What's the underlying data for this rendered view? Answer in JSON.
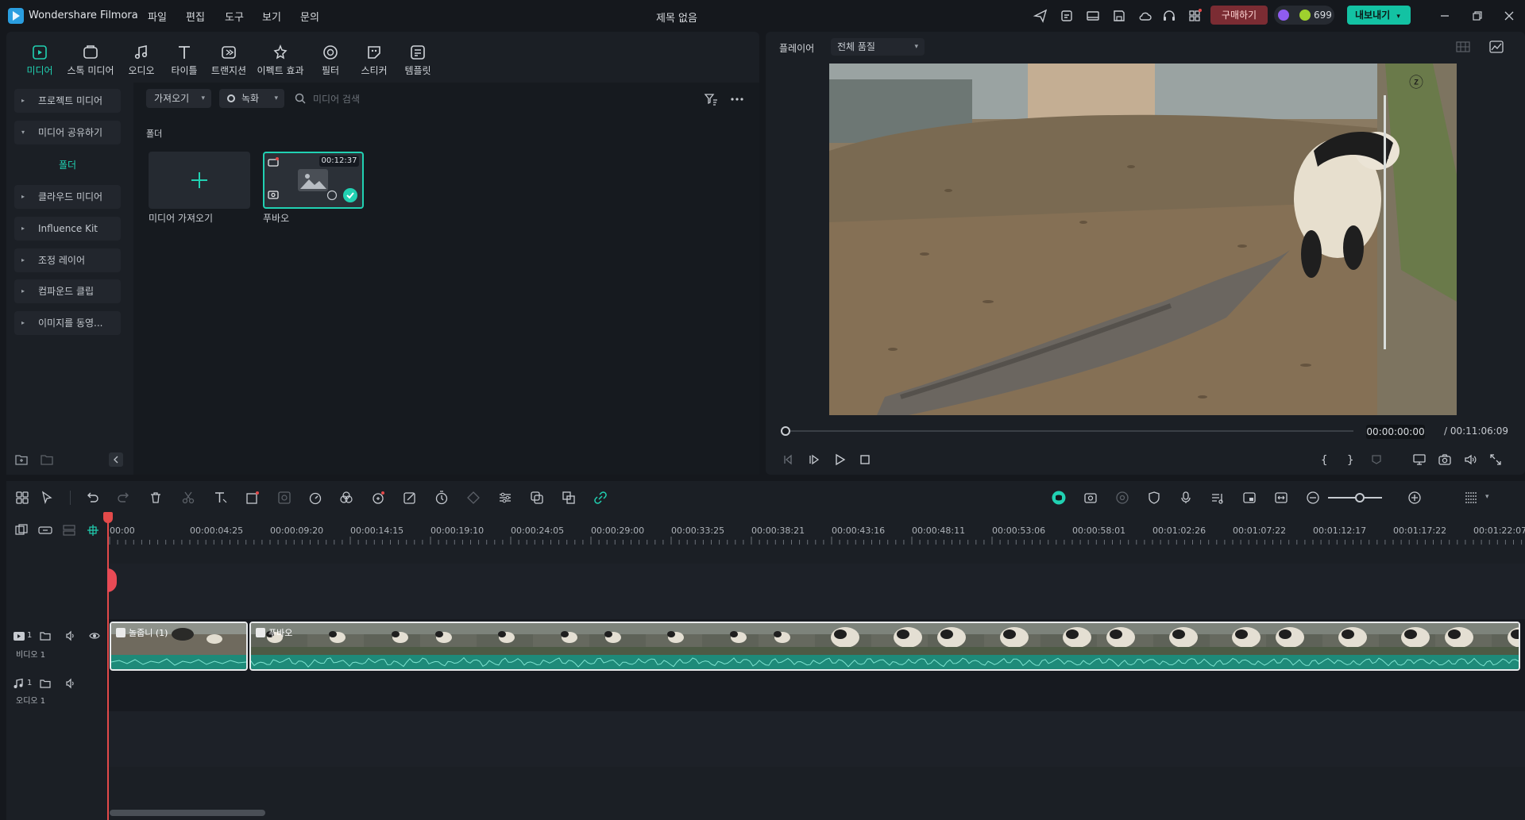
{
  "app": {
    "name": "Wondershare Filmora",
    "title": "제목 없음",
    "menu": [
      "파일",
      "편집",
      "도구",
      "보기",
      "문의"
    ],
    "buy_label": "구매하기",
    "credits": "699",
    "export_label": "내보내기"
  },
  "tabs": [
    "미디어",
    "스톡 미디어",
    "오디오",
    "타이틀",
    "트랜지션",
    "이펙트 효과",
    "필터",
    "스티커",
    "템플릿"
  ],
  "sidebar": {
    "items": [
      "프로젝트 미디어",
      "미디어 공유하기",
      "클라우드 미디어",
      "Influence Kit",
      "조정 레이어",
      "컴파운드 클립",
      "이미지를 동영..."
    ],
    "sub_item": "폴더"
  },
  "media": {
    "import_dropdown": "가져오기",
    "record_dropdown": "녹화",
    "search_placeholder": "미디어 검색",
    "folder_label": "폴더",
    "import_tile_label": "미디어 가져오기",
    "clip_name": "푸바오",
    "clip_duration": "00:12:37"
  },
  "player": {
    "label": "플레이어",
    "quality": "전체 품질",
    "current_time": "00:00:00:00",
    "total_time": "/ 00:11:06:09",
    "progress": 0
  },
  "timeline": {
    "ticks": [
      "00:00",
      "00:00:04:25",
      "00:00:09:20",
      "00:00:14:15",
      "00:00:19:10",
      "00:00:24:05",
      "00:00:29:00",
      "00:00:33:25",
      "00:00:38:21",
      "00:00:43:16",
      "00:00:48:11",
      "00:00:53:06",
      "00:00:58:01",
      "00:01:02:26",
      "00:01:07:22",
      "00:01:12:17",
      "00:01:17:22",
      "00:01:22:07"
    ],
    "video_track": "비디오 1",
    "video_track_num": "1",
    "audio_track": "오디오 1",
    "audio_track_num": "1",
    "clip1_label": "놀줍니 (1)",
    "clip2_label": "푸바오"
  },
  "colors": {
    "accent": "#21d1b2",
    "buy": "#7b2c33",
    "export": "#13c2a3",
    "playhead": "#e34a4a"
  }
}
